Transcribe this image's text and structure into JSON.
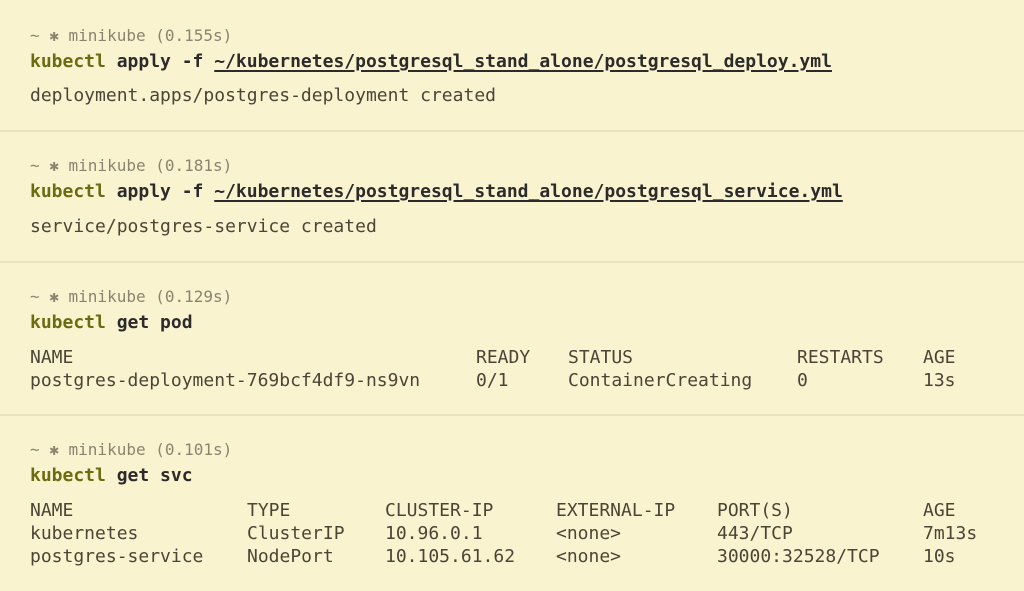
{
  "blocks": [
    {
      "prompt": "~ ✱ minikube (0.155s)",
      "command": {
        "kw": "kubectl",
        "rest": " apply -f ",
        "path": "~/kubernetes/postgresql_stand_alone/postgresql_deploy.yml"
      },
      "output": "deployment.apps/postgres-deployment created"
    },
    {
      "prompt": "~ ✱ minikube (0.181s)",
      "command": {
        "kw": "kubectl",
        "rest": " apply -f ",
        "path": "~/kubernetes/postgresql_stand_alone/postgresql_service.yml"
      },
      "output": "service/postgres-service created"
    },
    {
      "prompt": "~ ✱ minikube (0.129s)",
      "command": {
        "kw": "kubectl",
        "rest": " get pod"
      },
      "table": {
        "headers": [
          "NAME",
          "READY",
          "STATUS",
          "RESTARTS",
          "AGE"
        ],
        "rows": [
          [
            "postgres-deployment-769bcf4df9-ns9vn",
            "0/1",
            "ContainerCreating",
            "0",
            "13s"
          ]
        ]
      }
    },
    {
      "prompt": "~ ✱ minikube (0.101s)",
      "command": {
        "kw": "kubectl",
        "rest": " get svc"
      },
      "table": {
        "headers": [
          "NAME",
          "TYPE",
          "CLUSTER-IP",
          "EXTERNAL-IP",
          "PORT(S)",
          "AGE"
        ],
        "rows": [
          [
            "kubernetes",
            "ClusterIP",
            "10.96.0.1",
            "<none>",
            "443/TCP",
            "7m13s"
          ],
          [
            "postgres-service",
            "NodePort",
            "10.105.61.62",
            "<none>",
            "30000:32528/TCP",
            "10s"
          ]
        ]
      }
    }
  ]
}
